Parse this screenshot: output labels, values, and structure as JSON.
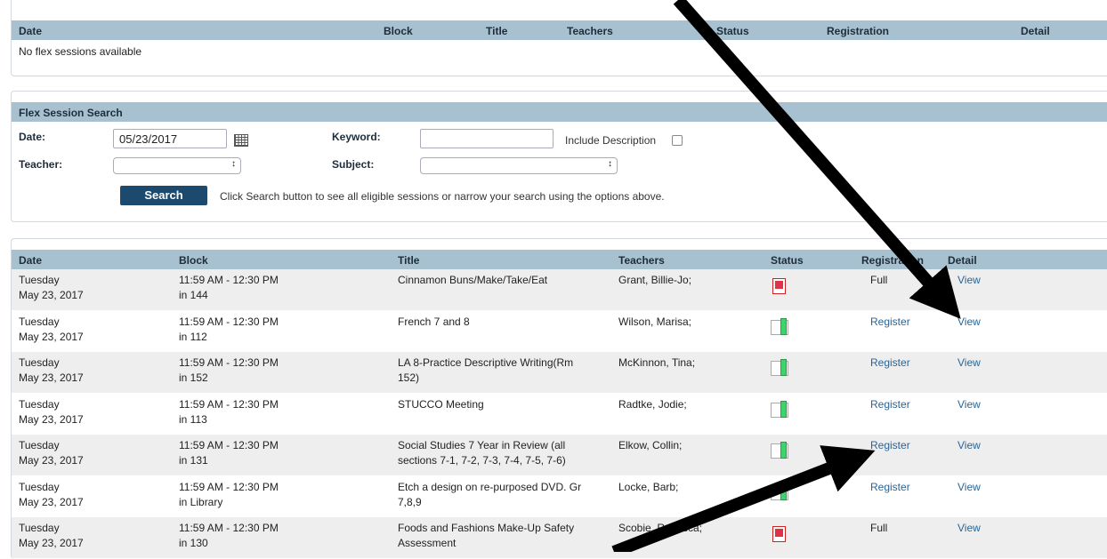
{
  "top_table": {
    "headers": {
      "date": "Date",
      "block": "Block",
      "title": "Title",
      "teachers": "Teachers",
      "status": "Status",
      "registration": "Registration",
      "detail": "Detail"
    },
    "empty_message": "No flex sessions available"
  },
  "search": {
    "heading": "Flex Session Search",
    "date_label": "Date:",
    "date_value": "05/23/2017",
    "keyword_label": "Keyword:",
    "keyword_value": "",
    "include_description_label": "Include Description",
    "teacher_label": "Teacher:",
    "subject_label": "Subject:",
    "teacher_value": "",
    "subject_value": "",
    "button_label": "Search",
    "hint": "Click Search button to see all eligible sessions or narrow your search using the options above."
  },
  "results": {
    "headers": {
      "date": "Date",
      "block": "Block",
      "title": "Title",
      "teachers": "Teachers",
      "status": "Status",
      "registration": "Registration",
      "detail": "Detail"
    },
    "rows": [
      {
        "day": "Tuesday",
        "date": "May 23, 2017",
        "time": "11:59 AM - 12:30 PM",
        "room": "in 144",
        "title1": "Cinnamon Buns/Make/Take/Eat",
        "title2": "",
        "teacher": "Grant, Billie-Jo;",
        "status": "full",
        "registration": "Full",
        "detail": "View"
      },
      {
        "day": "Tuesday",
        "date": "May 23, 2017",
        "time": "11:59 AM - 12:30 PM",
        "room": "in 112",
        "title1": "French 7 and 8",
        "title2": "",
        "teacher": "Wilson, Marisa;",
        "status": "open",
        "registration": "Register",
        "detail": "View"
      },
      {
        "day": "Tuesday",
        "date": "May 23, 2017",
        "time": "11:59 AM - 12:30 PM",
        "room": "in 152",
        "title1": "LA 8-Practice Descriptive Writing(Rm",
        "title2": "152)",
        "teacher": "McKinnon, Tina;",
        "status": "open",
        "registration": "Register",
        "detail": "View"
      },
      {
        "day": "Tuesday",
        "date": "May 23, 2017",
        "time": "11:59 AM - 12:30 PM",
        "room": "in 113",
        "title1": "STUCCO Meeting",
        "title2": "",
        "teacher": "Radtke, Jodie;",
        "status": "open",
        "registration": "Register",
        "detail": "View"
      },
      {
        "day": "Tuesday",
        "date": "May 23, 2017",
        "time": "11:59 AM - 12:30 PM",
        "room": "in 131",
        "title1": "Social Studies 7 Year in Review (all",
        "title2": "sections 7-1, 7-2, 7-3, 7-4, 7-5, 7-6)",
        "teacher": "Elkow, Collin;",
        "status": "open",
        "registration": "Register",
        "detail": "View"
      },
      {
        "day": "Tuesday",
        "date": "May 23, 2017",
        "time": "11:59 AM - 12:30 PM",
        "room": "in Library",
        "title1": "Etch a design on re-purposed DVD. Gr",
        "title2": "7,8,9",
        "teacher": "Locke, Barb;",
        "status": "open",
        "registration": "Register",
        "detail": "View"
      },
      {
        "day": "Tuesday",
        "date": "May 23, 2017",
        "time": "11:59 AM - 12:30 PM",
        "room": "in 130",
        "title1": "Foods and Fashions Make-Up Safety",
        "title2": "Assessment",
        "teacher": "Scobie, Rebecca;",
        "status": "full",
        "registration": "Full",
        "detail": "View"
      }
    ]
  }
}
